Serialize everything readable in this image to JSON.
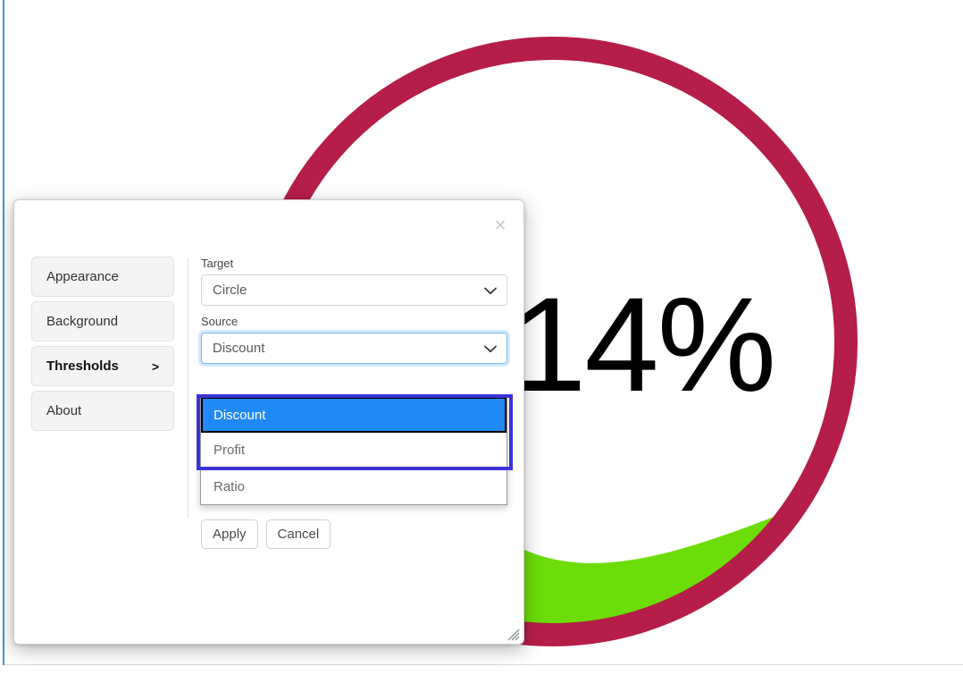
{
  "visualization": {
    "value_text": "14%",
    "circle_color": "#b51e48",
    "wave_color": "#6cdd08",
    "value_color": "#000000"
  },
  "dialog": {
    "close_label": "×",
    "sidebar": {
      "items": [
        {
          "label": "Appearance",
          "active": false,
          "chevron": ""
        },
        {
          "label": "Background",
          "active": false,
          "chevron": ""
        },
        {
          "label": "Thresholds",
          "active": true,
          "chevron": ">"
        },
        {
          "label": "About",
          "active": false,
          "chevron": ""
        }
      ]
    },
    "fields": {
      "target": {
        "label": "Target",
        "value": "Circle",
        "options": [
          "Circle"
        ]
      },
      "source": {
        "label": "Source",
        "value": "Discount",
        "focused": true,
        "expanded": true,
        "options": [
          {
            "label": "Discount",
            "selected": true
          },
          {
            "label": "Profit",
            "selected": false
          },
          {
            "label": "Ratio",
            "selected": false
          }
        ]
      }
    },
    "buttons": {
      "apply": "Apply",
      "cancel": "Cancel"
    }
  },
  "annotation": {
    "outline_color": "#3a34d6",
    "highlight_color": "#2089f5"
  }
}
